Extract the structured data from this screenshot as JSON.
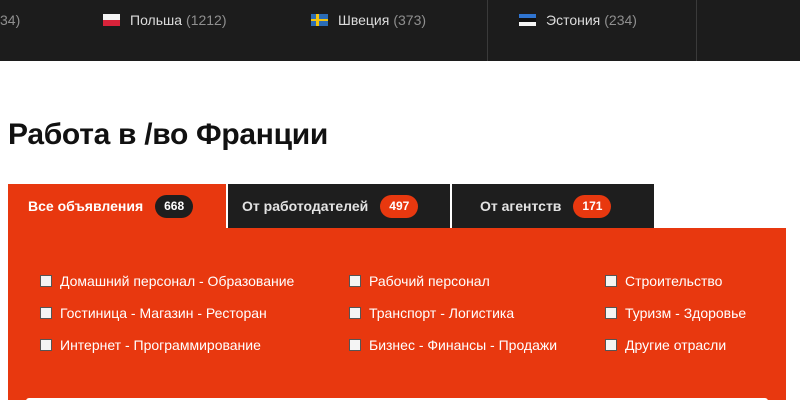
{
  "countries": [
    {
      "name": "",
      "count": "34)",
      "flag": "none"
    },
    {
      "name": "Польша",
      "count": "(1212)",
      "flag": "pl-flag"
    },
    {
      "name": "Швеция",
      "count": "(373)",
      "flag": "se-flag"
    },
    {
      "name": "Эстония",
      "count": "(234)",
      "flag": "ee-flag"
    }
  ],
  "page": {
    "title": "Работа в /во Франции"
  },
  "tabs": [
    {
      "label": "Все объявления",
      "count": "668"
    },
    {
      "label": "От работодателей",
      "count": "497"
    },
    {
      "label": "От агентств",
      "count": "171"
    }
  ],
  "categories": [
    {
      "label": "Домашний персонал - Образование"
    },
    {
      "label": "Гостиница - Магазин - Ресторан"
    },
    {
      "label": "Интернет - Программирование"
    },
    {
      "label": "Рабочий персонал"
    },
    {
      "label": "Транспорт - Логистика"
    },
    {
      "label": "Бизнес - Финансы - Продажи"
    },
    {
      "label": "Строительство"
    },
    {
      "label": "Туризм - Здоровье"
    },
    {
      "label": "Другие отрасли"
    }
  ],
  "colors": {
    "accent": "#e8380f",
    "dark": "#1e1e1e",
    "topbar": "#1c1c1c"
  }
}
